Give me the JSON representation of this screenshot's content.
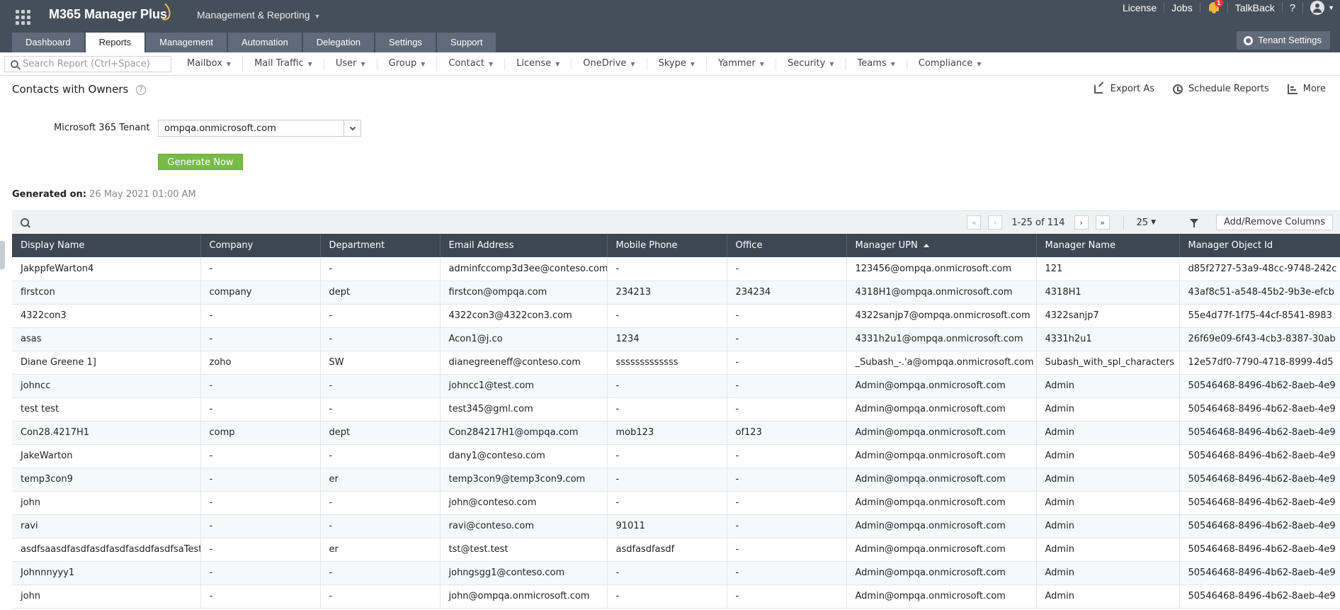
{
  "app": {
    "brand": "M365 Manager Plus",
    "switcher_label": "Management & Reporting",
    "top_links": [
      "License",
      "Jobs",
      "TalkBack",
      "?"
    ],
    "notification_count": "1"
  },
  "nav": {
    "tabs": [
      {
        "label": "Dashboard",
        "active": false
      },
      {
        "label": "Reports",
        "active": true
      },
      {
        "label": "Management",
        "active": false
      },
      {
        "label": "Automation",
        "active": false
      },
      {
        "label": "Delegation",
        "active": false
      },
      {
        "label": "Settings",
        "active": false
      },
      {
        "label": "Support",
        "active": false
      }
    ],
    "tenant_settings_label": "Tenant Settings"
  },
  "menubar": {
    "search_placeholder": "Search Report (Ctrl+Space)",
    "menus": [
      "Mailbox",
      "Mail Traffic",
      "User",
      "Group",
      "Contact",
      "License",
      "OneDrive",
      "Skype",
      "Yammer",
      "Security",
      "Teams",
      "Compliance"
    ]
  },
  "page": {
    "title": "Contacts with Owners",
    "help": "?",
    "actions": {
      "export": "Export As",
      "schedule": "Schedule Reports",
      "more": "More"
    }
  },
  "form": {
    "tenant_label": "Microsoft 365 Tenant",
    "tenant_value": "ompqa.onmicrosoft.com",
    "generate_label": "Generate Now",
    "generated_label": "Generated on:",
    "generated_value": "26 May 2021 01:00 AM"
  },
  "grid": {
    "pager_text": "1-25 of 114",
    "per_page": "25",
    "add_remove_label": "Add/Remove Columns",
    "sort_column": "Manager UPN",
    "columns": [
      "Display Name",
      "Company",
      "Department",
      "Email Address",
      "Mobile Phone",
      "Office",
      "Manager UPN",
      "Manager Name",
      "Manager Object Id"
    ],
    "rows": [
      [
        "JakppfeWarton4",
        "-",
        "-",
        "adminfccomp3d3ee@conteso.com",
        "-",
        "-",
        "123456@ompqa.onmicrosoft.com",
        "121",
        "d85f2727-53a9-48cc-9748-242c"
      ],
      [
        "firstcon",
        "company",
        "dept",
        "firstcon@ompqa.com",
        "234213",
        "234234",
        "4318H1@ompqa.onmicrosoft.com",
        "4318H1",
        "43af8c51-a548-45b2-9b3e-efcb"
      ],
      [
        "4322con3",
        "-",
        "-",
        "4322con3@4322con3.com",
        "-",
        "-",
        "4322sanjp7@ompqa.onmicrosoft.com",
        "4322sanjp7",
        "55e4d77f-1f75-44cf-8541-8983"
      ],
      [
        "asas",
        "-",
        "-",
        "Acon1@j.co",
        "1234",
        "-",
        "4331h2u1@ompqa.onmicrosoft.com",
        "4331h2u1",
        "26f69e09-6f43-4cb3-8387-30ab"
      ],
      [
        "Diane Greene 1]",
        "zoho",
        "SW",
        "dianegreeneff@conteso.com",
        "sssssssssssss",
        "-",
        "_Subash_-.'a@ompqa.onmicrosoft.com",
        "Subash_with_spl_characters",
        "12e57df0-7790-4718-8999-4d5"
      ],
      [
        "johncc",
        "-",
        "-",
        "johncc1@test.com",
        "-",
        "-",
        "Admin@ompqa.onmicrosoft.com",
        "Admin",
        "50546468-8496-4b62-8aeb-4e9"
      ],
      [
        "test test",
        "-",
        "-",
        "test345@gml.com",
        "-",
        "-",
        "Admin@ompqa.onmicrosoft.com",
        "Admin",
        "50546468-8496-4b62-8aeb-4e9"
      ],
      [
        "Con28.4217H1",
        "comp",
        "dept",
        "Con284217H1@ompqa.com",
        "mob123",
        "of123",
        "Admin@ompqa.onmicrosoft.com",
        "Admin",
        "50546468-8496-4b62-8aeb-4e9"
      ],
      [
        "JakeWarton",
        "-",
        "-",
        "dany1@conteso.com",
        "-",
        "-",
        "Admin@ompqa.onmicrosoft.com",
        "Admin",
        "50546468-8496-4b62-8aeb-4e9"
      ],
      [
        "temp3con9",
        "-",
        "er",
        "temp3con9@temp3con9.com",
        "-",
        "-",
        "Admin@ompqa.onmicrosoft.com",
        "Admin",
        "50546468-8496-4b62-8aeb-4e9"
      ],
      [
        "john",
        "-",
        "-",
        "john@conteso.com",
        "-",
        "-",
        "Admin@ompqa.onmicrosoft.com",
        "Admin",
        "50546468-8496-4b62-8aeb-4e9"
      ],
      [
        "ravi",
        "-",
        "-",
        "ravi@conteso.com",
        "91011",
        "-",
        "Admin@ompqa.onmicrosoft.com",
        "Admin",
        "50546468-8496-4b62-8aeb-4e9"
      ],
      [
        "asdfsaasdfasdfasdfasdfasddfasdfsaTest",
        "-",
        "er",
        "tst@test.test",
        "asdfasdfasdf",
        "-",
        "Admin@ompqa.onmicrosoft.com",
        "Admin",
        "50546468-8496-4b62-8aeb-4e9"
      ],
      [
        "Johnnnyyy1",
        "-",
        "-",
        "johngsgg1@conteso.com",
        "-",
        "-",
        "Admin@ompqa.onmicrosoft.com",
        "Admin",
        "50546468-8496-4b62-8aeb-4e9"
      ],
      [
        "john",
        "-",
        "-",
        "john@ompqa.onmicrosoft.com",
        "-",
        "-",
        "Admin@ompqa.onmicrosoft.com",
        "Admin",
        "50546468-8496-4b62-8aeb-4e9"
      ]
    ]
  }
}
